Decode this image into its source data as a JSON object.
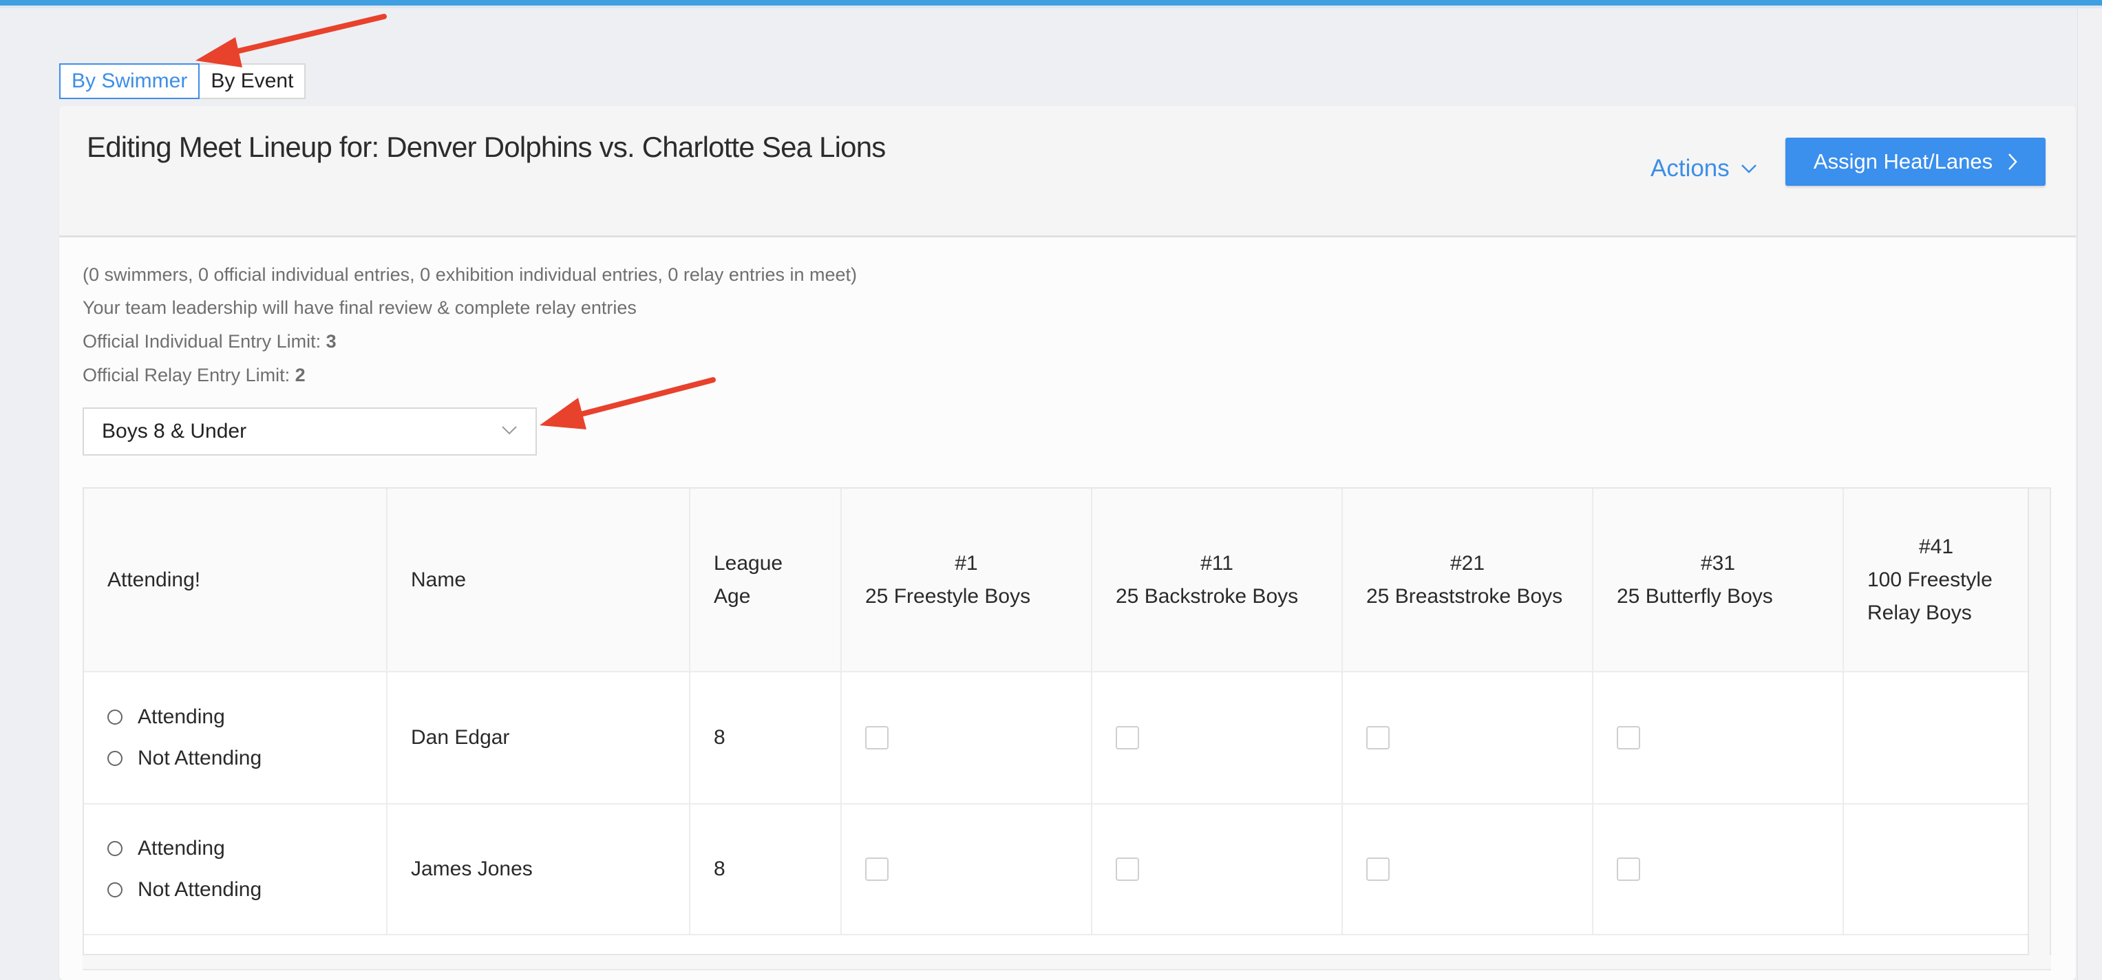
{
  "view_toggle": {
    "by_swimmer": "By Swimmer",
    "by_event": "By Event",
    "active": "by_swimmer"
  },
  "header": {
    "title": "Editing Meet Lineup for: Denver Dolphins vs. Charlotte Sea Lions",
    "actions_label": "Actions",
    "assign_label": "Assign Heat/Lanes"
  },
  "info": {
    "summary": "(0 swimmers, 0 official individual entries, 0 exhibition individual entries, 0 relay entries in meet)",
    "leadership_note": "Your team leadership will have final review & complete relay entries",
    "individual_limit_label": "Official Individual Entry Limit:",
    "individual_limit_value": "3",
    "relay_limit_label": "Official Relay Entry Limit:",
    "relay_limit_value": "2"
  },
  "age_group_select": {
    "selected": "Boys 8 & Under"
  },
  "table": {
    "headers": {
      "attending": "Attending!",
      "name": "Name",
      "league_age_1": "League",
      "league_age_2": "Age"
    },
    "events": [
      {
        "number": "#1",
        "name": "25 Freestyle Boys"
      },
      {
        "number": "#11",
        "name": "25 Backstroke Boys"
      },
      {
        "number": "#21",
        "name": "25 Breaststroke Boys"
      },
      {
        "number": "#31",
        "name": "25 Butterfly Boys"
      },
      {
        "number": "#41",
        "name": "100 Freestyle Relay Boys"
      }
    ],
    "attending_option": "Attending",
    "not_attending_option": "Not Attending",
    "rows": [
      {
        "name": "Dan Edgar",
        "age": "8"
      },
      {
        "name": "James Jones",
        "age": "8"
      }
    ]
  },
  "colors": {
    "accent": "#3b8fed",
    "annotation_arrow": "#e8412c",
    "topbar": "#3f9fe0"
  }
}
